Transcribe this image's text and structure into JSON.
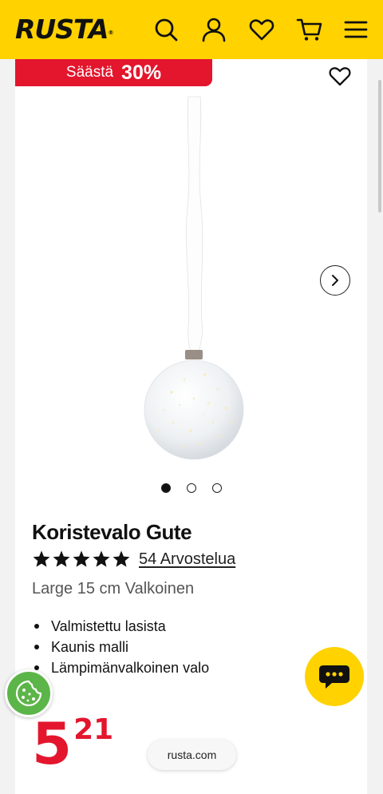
{
  "header": {
    "logo": "RUSTA",
    "logo_mark": "®",
    "icons": [
      "search-icon",
      "account-icon",
      "heart-icon",
      "cart-icon",
      "menu-icon"
    ],
    "background": "#ffd200"
  },
  "product": {
    "save_badge": {
      "label": "Säästä",
      "percent": "30%",
      "color": "#e3162d"
    },
    "image_count": 3,
    "active_image": 1,
    "name": "Koristevalo Gute",
    "rating": {
      "stars": 5,
      "max": 5,
      "reviews_label": "54 Arvostelua"
    },
    "variant": "Large 15 cm Valkoinen",
    "features": [
      "Valmistettu lasista",
      "Kaunis malli",
      "Lämpimänvalkoinen valo"
    ],
    "price": {
      "integer": "5",
      "decimals": "21",
      "color": "#e3162d"
    }
  },
  "browser": {
    "url": "rusta.com"
  },
  "floating": {
    "cookie": "cookie-icon",
    "chat": "chat-icon"
  }
}
